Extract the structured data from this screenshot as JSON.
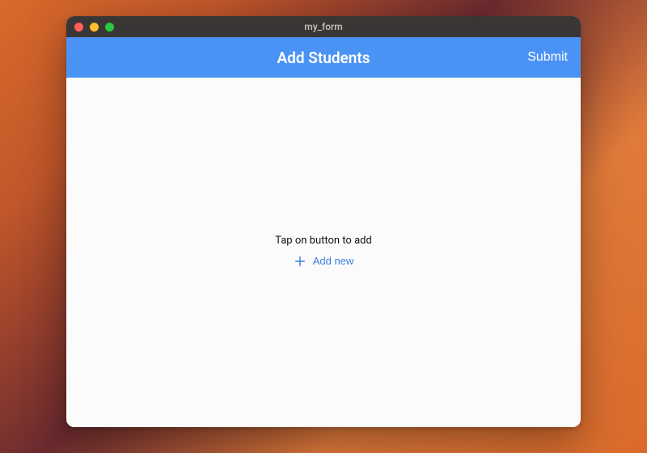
{
  "window": {
    "title": "my_form"
  },
  "appbar": {
    "title": "Add Students",
    "submit_label": "Submit"
  },
  "content": {
    "empty_hint": "Tap on button to add",
    "add_label": "Add new"
  },
  "colors": {
    "appbar_bg": "#4a93f5",
    "accent": "#3f7fe0"
  }
}
